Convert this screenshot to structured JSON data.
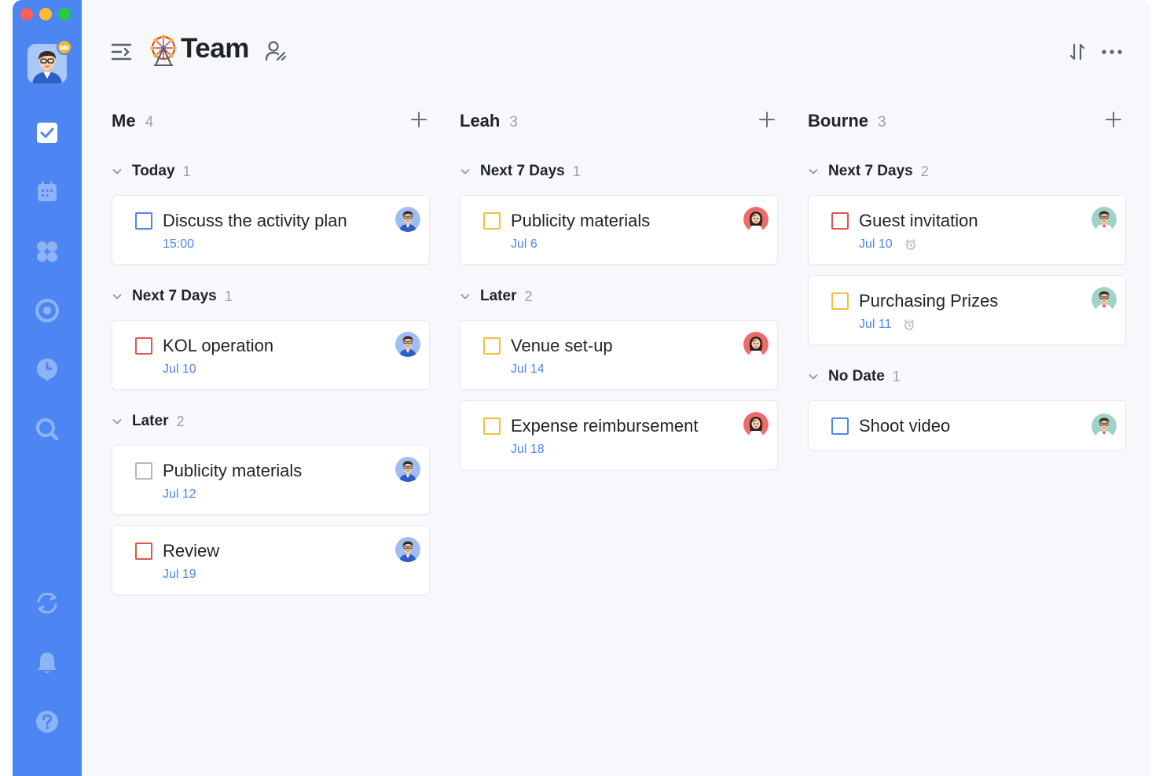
{
  "header": {
    "title": "Team",
    "title_emoji": "🎡"
  },
  "columns": [
    {
      "name": "Me",
      "count": "4",
      "sections": [
        {
          "label": "Today",
          "count": "1",
          "cards": [
            {
              "title": "Discuss the activity plan",
              "date": "15:00",
              "priority": "blue",
              "assignee": "man-blue"
            }
          ]
        },
        {
          "label": "Next 7 Days",
          "count": "1",
          "cards": [
            {
              "title": "KOL operation",
              "date": "Jul 10",
              "priority": "red",
              "assignee": "man-blue"
            }
          ]
        },
        {
          "label": "Later",
          "count": "2",
          "cards": [
            {
              "title": "Publicity materials",
              "date": "Jul 12",
              "priority": "gray",
              "assignee": "man-blue"
            },
            {
              "title": "Review",
              "date": "Jul 19",
              "priority": "red",
              "assignee": "man-blue"
            }
          ]
        }
      ]
    },
    {
      "name": "Leah",
      "count": "3",
      "sections": [
        {
          "label": "Next 7 Days",
          "count": "1",
          "cards": [
            {
              "title": "Publicity materials",
              "date": "Jul 6",
              "priority": "yellow",
              "assignee": "woman-red"
            }
          ]
        },
        {
          "label": "Later",
          "count": "2",
          "cards": [
            {
              "title": "Venue set-up",
              "date": "Jul 14",
              "priority": "yellow",
              "assignee": "woman-red"
            },
            {
              "title": "Expense reimbursement",
              "date": "Jul 18",
              "priority": "yellow",
              "assignee": "woman-red"
            }
          ]
        }
      ]
    },
    {
      "name": "Bourne",
      "count": "3",
      "sections": [
        {
          "label": "Next 7 Days",
          "count": "2",
          "cards": [
            {
              "title": "Guest invitation",
              "date": "Jul 10",
              "priority": "red",
              "assignee": "man-teal",
              "alarm": true
            },
            {
              "title": "Purchasing Prizes",
              "date": "Jul 11",
              "priority": "yellow",
              "assignee": "man-teal",
              "alarm": true
            }
          ]
        },
        {
          "label": "No Date",
          "count": "1",
          "cards": [
            {
              "title": "Shoot video",
              "date": "",
              "priority": "blue",
              "assignee": "man-teal"
            }
          ]
        }
      ]
    }
  ],
  "colors": {
    "sidebar": "#4d86f2",
    "accent": "#4d86f2",
    "priority_red": "#e5534b",
    "priority_yellow": "#f5bf3c",
    "priority_blue": "#4d86f2",
    "priority_gray": "#b4b8bf"
  },
  "icons": {
    "sidebar": [
      "checkbox-icon",
      "calendar-icon",
      "grid-icon",
      "target-icon",
      "clock-icon",
      "search-icon",
      "sync-icon",
      "bell-icon",
      "help-icon"
    ],
    "topbar": [
      "menu-toggle-icon",
      "team-members-icon",
      "sort-icon",
      "more-icon"
    ]
  }
}
